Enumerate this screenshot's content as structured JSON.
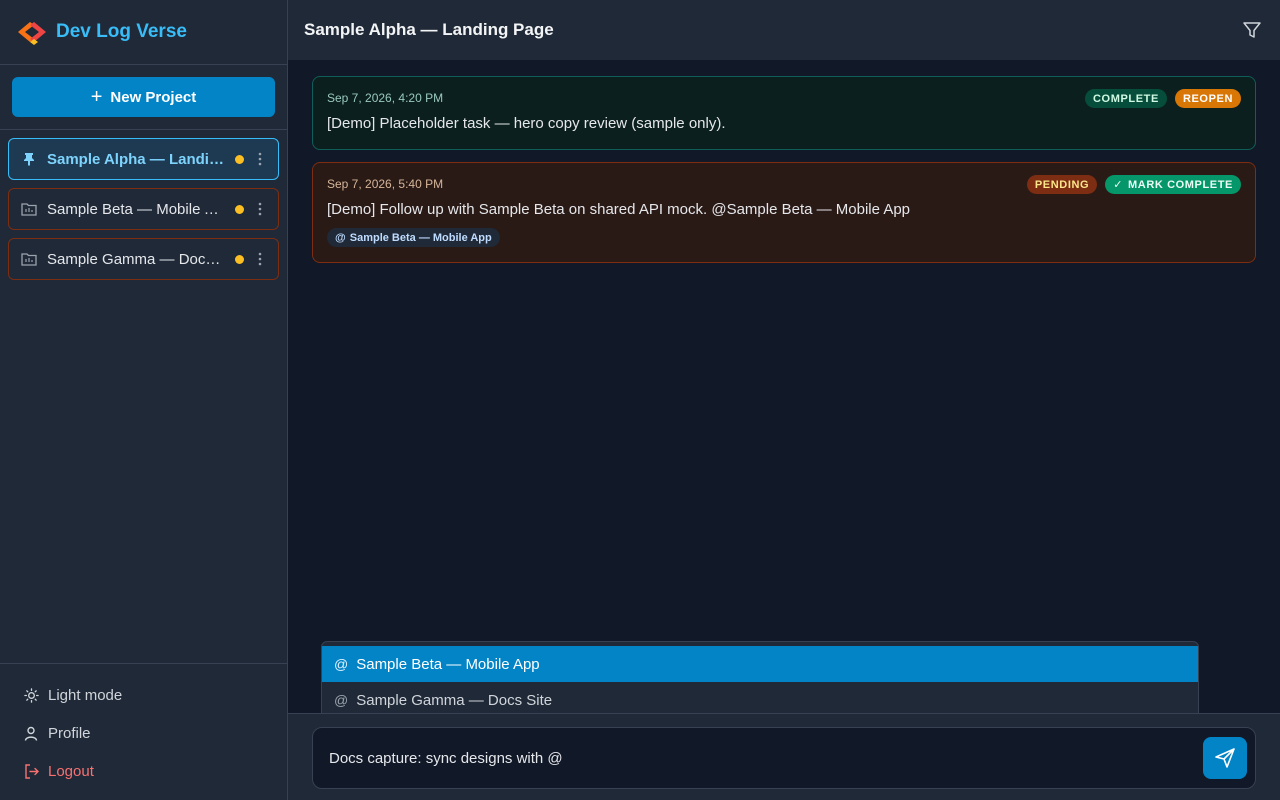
{
  "app": {
    "title": "Dev Log Verse"
  },
  "sidebar": {
    "new_project_label": "New Project",
    "projects": [
      {
        "name": "Sample Alpha — Landing Page",
        "active": true
      },
      {
        "name": "Sample Beta — Mobile App",
        "active": false
      },
      {
        "name": "Sample Gamma — Docs Site",
        "active": false
      }
    ],
    "bottom": {
      "light_mode": "Light mode",
      "profile": "Profile",
      "logout": "Logout"
    }
  },
  "header": {
    "title": "Sample Alpha — Landing Page"
  },
  "entries": [
    {
      "date": "Sep 7, 2026, 4:20 PM",
      "text": "[Demo] Placeholder task — hero copy review (sample only).",
      "status_badge": "COMPLETE",
      "action_label": "REOPEN"
    },
    {
      "date": "Sep 7, 2026, 5:40 PM",
      "text": "[Demo] Follow up with Sample Beta on shared API mock. @Sample Beta — Mobile App",
      "status_badge": "PENDING",
      "action_label": "MARK COMPLETE",
      "mention": "Sample Beta — Mobile App"
    }
  ],
  "suggestions": {
    "items": [
      "Sample Beta — Mobile App",
      "Sample Gamma — Docs Site"
    ]
  },
  "composer": {
    "value": "Docs capture: sync designs with @"
  },
  "colors": {
    "accent": "#0284c7",
    "brand": "#38bdf8",
    "pending_dot": "#fbbf24",
    "complete": "#059669",
    "reopen": "#d97706",
    "logout": "#f87171"
  }
}
